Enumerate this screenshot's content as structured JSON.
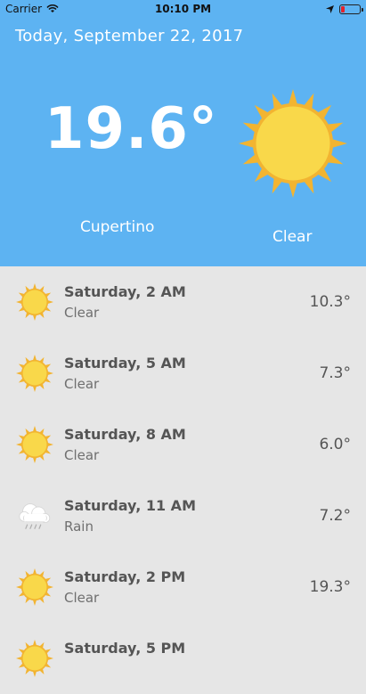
{
  "status_bar": {
    "carrier": "Carrier",
    "time": "10:10 PM"
  },
  "header": {
    "date": "Today, September 22, 2017",
    "temperature": "19.6°",
    "city": "Cupertino",
    "condition": "Clear",
    "icon": "sun-icon"
  },
  "forecast": [
    {
      "day": "Saturday, 2 AM",
      "condition": "Clear",
      "temp": "10.3°",
      "icon": "sun-icon"
    },
    {
      "day": "Saturday, 5 AM",
      "condition": "Clear",
      "temp": "7.3°",
      "icon": "sun-icon"
    },
    {
      "day": "Saturday, 8 AM",
      "condition": "Clear",
      "temp": "6.0°",
      "icon": "sun-icon"
    },
    {
      "day": "Saturday, 11 AM",
      "condition": "Rain",
      "temp": "7.2°",
      "icon": "rain-cloud-icon"
    },
    {
      "day": "Saturday, 2 PM",
      "condition": "Clear",
      "temp": "19.3°",
      "icon": "sun-icon"
    },
    {
      "day": "Saturday, 5 PM",
      "condition": "",
      "temp": "",
      "icon": "sun-icon"
    }
  ],
  "colors": {
    "header_bg": "#5db3f2",
    "list_bg": "#e6e6e6",
    "sun": "#f9d84a",
    "sun_rays": "#f2b431"
  }
}
